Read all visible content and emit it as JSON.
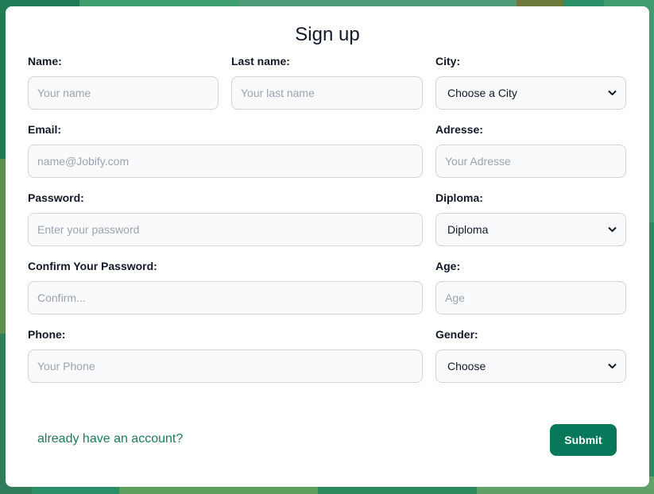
{
  "form": {
    "title": "Sign up",
    "fields": {
      "name": {
        "label": "Name:",
        "placeholder": "Your name"
      },
      "last_name": {
        "label": "Last name:",
        "placeholder": "Your last name"
      },
      "city": {
        "label": "City:",
        "selected": "Choose a City"
      },
      "email": {
        "label": "Email:",
        "placeholder": "name@Jobify.com"
      },
      "address": {
        "label": "Adresse:",
        "placeholder": "Your Adresse"
      },
      "password": {
        "label": "Password:",
        "placeholder": "Enter your password"
      },
      "diploma": {
        "label": "Diploma:",
        "selected": "Diploma"
      },
      "confirm_password": {
        "label": "Confirm Your Password:",
        "placeholder": "Confirm..."
      },
      "age": {
        "label": "Age:",
        "placeholder": "Age"
      },
      "phone": {
        "label": "Phone:",
        "placeholder": "Your Phone"
      },
      "gender": {
        "label": "Gender:",
        "selected": "Choose"
      }
    },
    "login_link": "already have an account?",
    "submit_label": "Submit"
  },
  "colors": {
    "accent": "#07785a",
    "link": "#1e7a57",
    "field_bg": "#f9fafb",
    "field_border": "#d1d5db"
  },
  "icons": {
    "select_arrow": "chevron-down-icon"
  }
}
